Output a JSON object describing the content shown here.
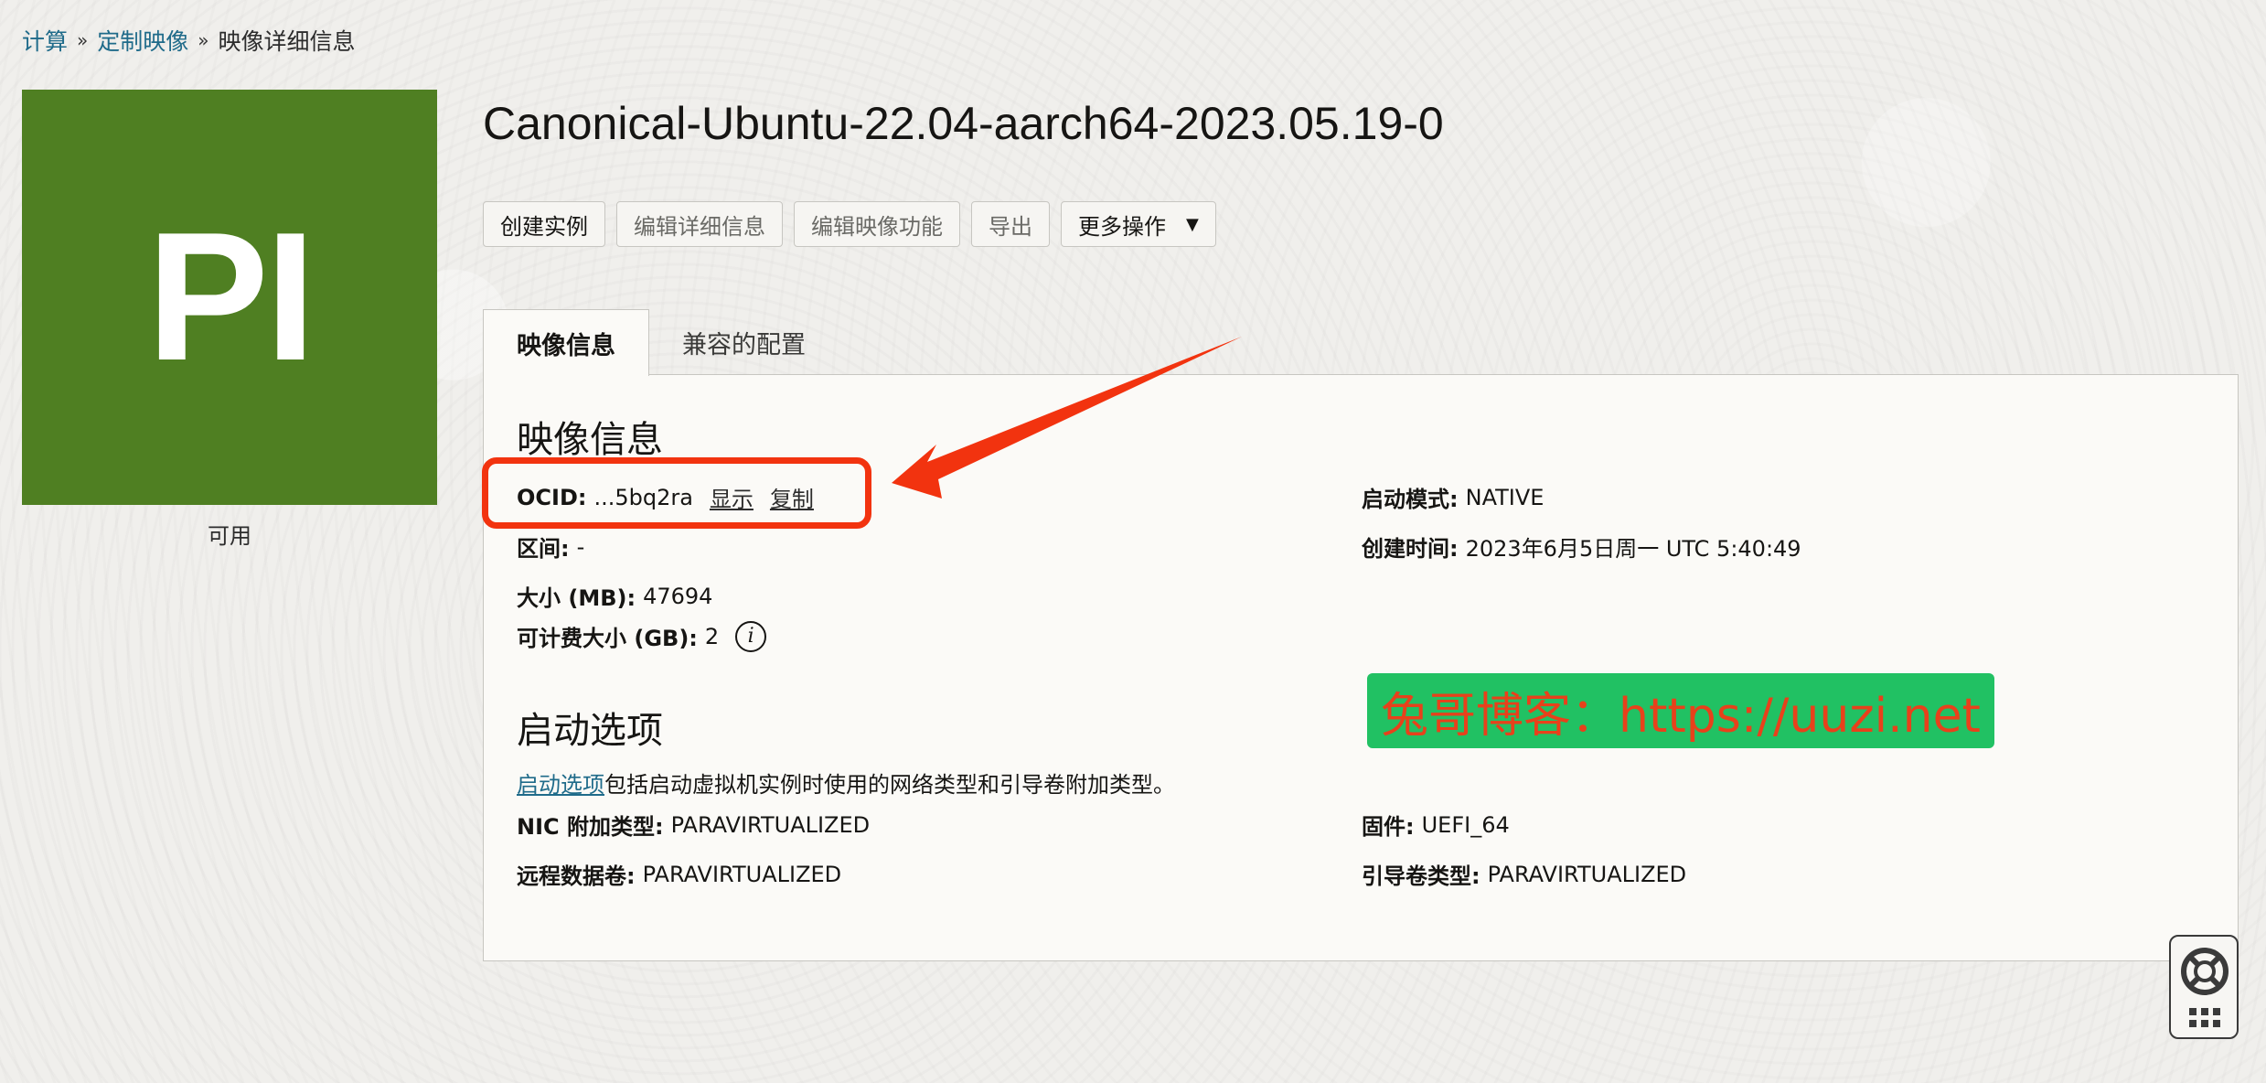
{
  "breadcrumb": {
    "items": [
      "计算",
      "定制映像"
    ],
    "separator": "»",
    "current": "映像详细信息"
  },
  "avatar": {
    "initials": "PI",
    "color": "#4f7f22"
  },
  "status": "可用",
  "title": "Canonical-Ubuntu-22.04-aarch64-2023.05.19-0",
  "actions": {
    "create_instance": "创建实例",
    "edit_details": "编辑详细信息",
    "edit_capabilities": "编辑映像功能",
    "export": "导出",
    "more_actions": "更多操作"
  },
  "tabs": [
    "映像信息",
    "兼容的配置"
  ],
  "image_info": {
    "heading": "映像信息",
    "ocid_label": "OCID:",
    "ocid_value": "...5bq2ra",
    "show_link": "显示",
    "copy_link": "复制",
    "zone_label": "区间:",
    "zone_value": "-",
    "size_label": "大小 (MB):",
    "size_value": "47694",
    "billable_label": "可计费大小 (GB):",
    "billable_value": "2",
    "launch_mode_label": "启动模式:",
    "launch_mode_value": "NATIVE",
    "created_label": "创建时间:",
    "created_value": "2023年6月5日周一 UTC 5:40:49"
  },
  "launch_options": {
    "heading": "启动选项",
    "desc_link": "启动选项",
    "desc_text": "包括启动虚拟机实例时使用的网络类型和引导卷附加类型。",
    "nic_label": "NIC 附加类型:",
    "nic_value": "PARAVIRTUALIZED",
    "firmware_label": "固件:",
    "firmware_value": "UEFI_64",
    "remote_label": "远程数据卷:",
    "remote_value": "PARAVIRTUALIZED",
    "boot_label": "引导卷类型:",
    "boot_value": "PARAVIRTUALIZED"
  },
  "watermark": "兔哥博客：https://uuzi.net",
  "colors": {
    "link": "#1f6b8a",
    "annotation": "#f2330f",
    "watermark_bg": "#21c163",
    "watermark_text": "#e8411b"
  }
}
